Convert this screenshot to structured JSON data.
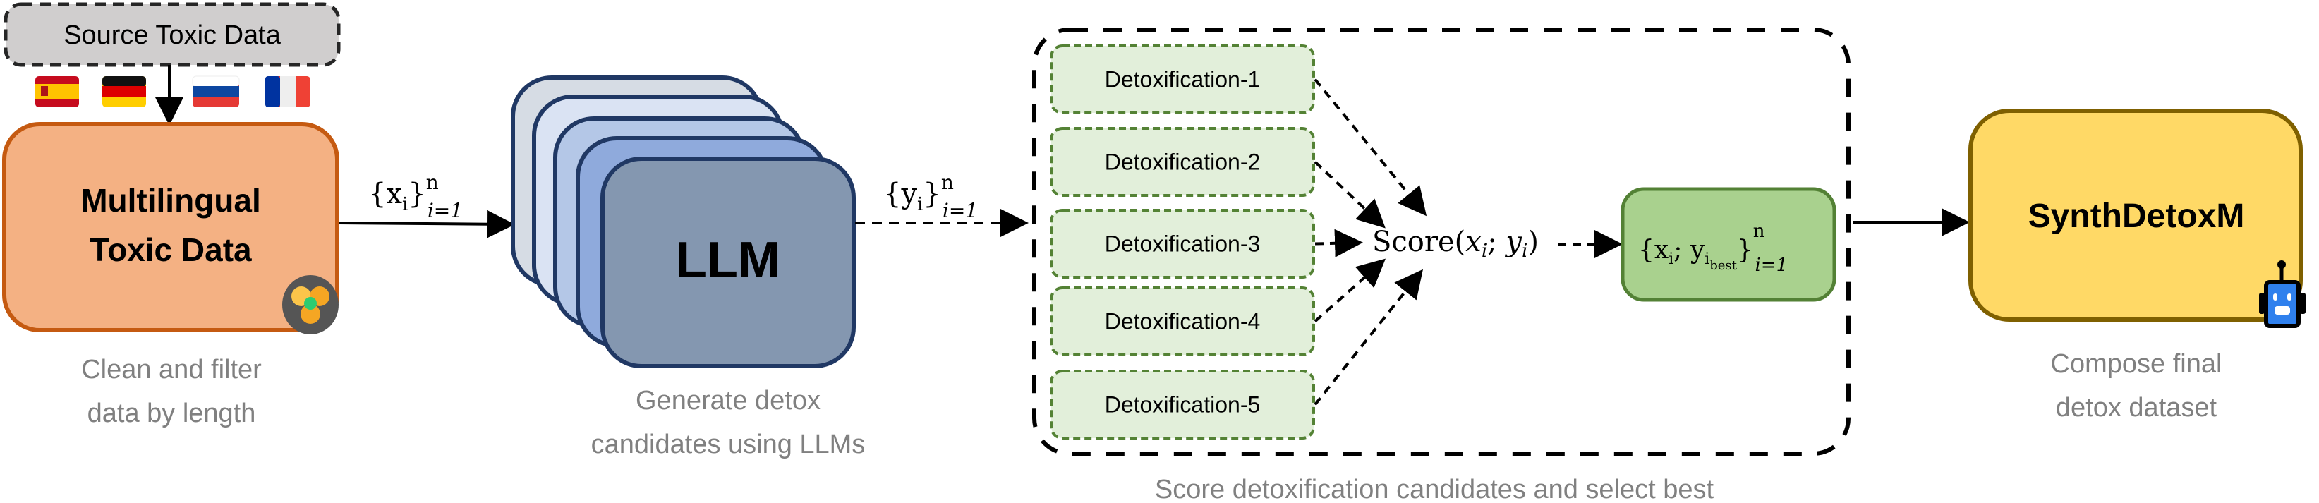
{
  "source": {
    "label": "Source Toxic Data"
  },
  "flags": [
    {
      "name": "spain-flag-icon"
    },
    {
      "name": "germany-flag-icon"
    },
    {
      "name": "russia-flag-icon"
    },
    {
      "name": "france-flag-icon"
    }
  ],
  "stage1": {
    "title_line1": "Multilingual",
    "title_line2": "Toxic Data",
    "icon": "biohazard-icon",
    "caption_line1": "Clean and filter",
    "caption_line2": "data by length",
    "color": "#f4b183",
    "border": "#c55a11"
  },
  "edge1": {
    "base": "{x",
    "sub": "i",
    "close": "}",
    "sup": "n",
    "lower": "i=1"
  },
  "stage2": {
    "title": "LLM",
    "caption_line1": "Generate detox",
    "caption_line2": "candidates using LLMs",
    "layer_colors": [
      "#d6dce4",
      "#dae3f3",
      "#b4c7e7",
      "#8faadc",
      "#8497b0"
    ],
    "border": "#203864"
  },
  "edge2": {
    "base": "{y",
    "sub": "i",
    "close": "}",
    "sup": "n",
    "lower": "i=1"
  },
  "stage3": {
    "candidates": [
      "Detoxification-1",
      "Detoxification-2",
      "Detoxification-3",
      "Detoxification-4",
      "Detoxification-5"
    ],
    "score": {
      "fn": "Score(",
      "x": "x",
      "xi": "i",
      "sep": "; ",
      "y": "y",
      "yi": "i",
      "close": ")"
    },
    "result": {
      "open": "{x",
      "sub": "i",
      "sep": "; y",
      "sub2": "i",
      "subsub": "best",
      "close": "}",
      "sup": "n",
      "lower": "i=1"
    },
    "caption": "Score detoxification candidates and select best",
    "candidate_color": "#e2efda",
    "result_color": "#a9d18e"
  },
  "stage4": {
    "title": "SynthDetoxM",
    "icon": "robot-icon",
    "caption_line1": "Compose final",
    "caption_line2": "detox dataset",
    "color": "#ffd966",
    "border": "#7f6000"
  }
}
